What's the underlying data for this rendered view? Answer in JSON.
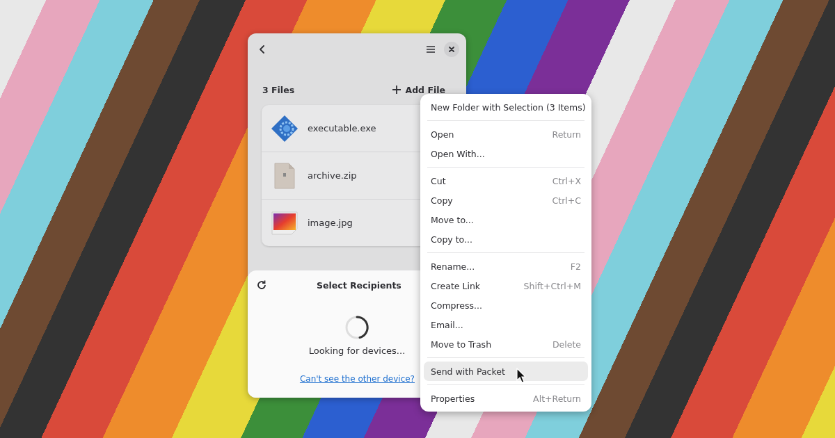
{
  "window": {
    "files_label": "3 Files",
    "add_file": "Add File",
    "files": [
      {
        "name": "executable.exe",
        "kind": "exe"
      },
      {
        "name": "archive.zip",
        "kind": "zip"
      },
      {
        "name": "image.jpg",
        "kind": "image"
      }
    ],
    "recipients": {
      "title": "Select Recipients",
      "status": "Looking for devices...",
      "link": "Can't see the other device?"
    }
  },
  "context_menu": {
    "sections": [
      [
        {
          "label": "New Folder with Selection (3 Items)",
          "selected": false
        }
      ],
      [
        {
          "label": "Open",
          "shortcut": "Return",
          "selected": false
        },
        {
          "label": "Open With...",
          "selected": false
        }
      ],
      [
        {
          "label": "Cut",
          "shortcut": "Ctrl+X",
          "selected": false
        },
        {
          "label": "Copy",
          "shortcut": "Ctrl+C",
          "selected": false
        },
        {
          "label": "Move to...",
          "selected": false
        },
        {
          "label": "Copy to...",
          "selected": false
        }
      ],
      [
        {
          "label": "Rename...",
          "shortcut": "F2",
          "selected": false
        },
        {
          "label": "Create Link",
          "shortcut": "Shift+Ctrl+M",
          "selected": false
        },
        {
          "label": "Compress...",
          "selected": false
        },
        {
          "label": "Email...",
          "selected": false
        },
        {
          "label": "Move to Trash",
          "shortcut": "Delete",
          "selected": false
        }
      ],
      [
        {
          "label": "Send with Packet",
          "selected": true
        }
      ],
      [
        {
          "label": "Properties",
          "shortcut": "Alt+Return",
          "selected": false
        }
      ]
    ]
  }
}
